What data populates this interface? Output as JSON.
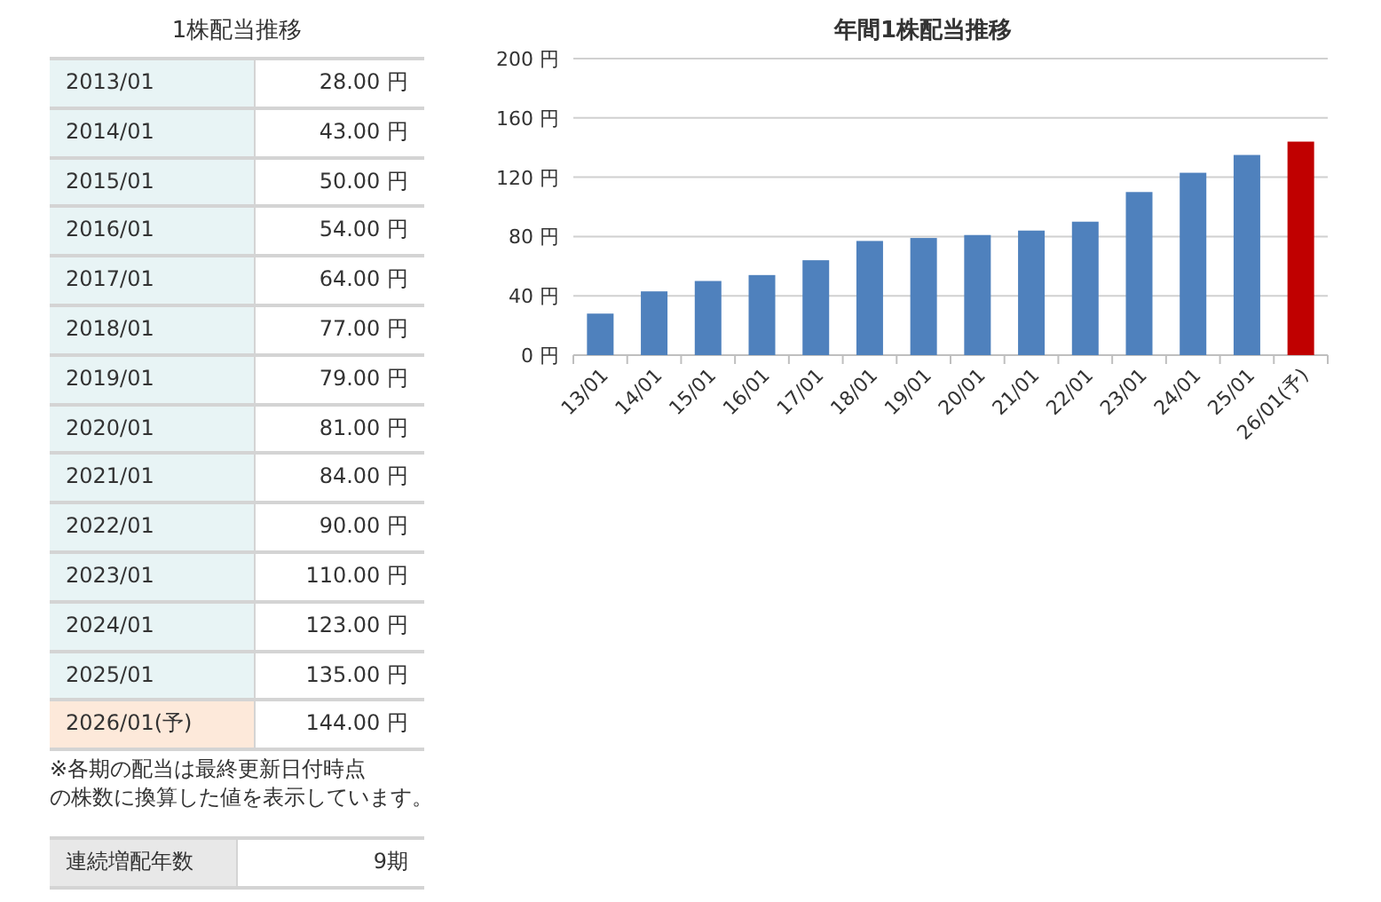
{
  "dividend_table": {
    "title": "1株配当推移",
    "rows": [
      {
        "kind": "actual",
        "period": "2013/01",
        "amount": "28.00 円"
      },
      {
        "kind": "actual",
        "period": "2014/01",
        "amount": "43.00 円"
      },
      {
        "kind": "actual",
        "period": "2015/01",
        "amount": "50.00 円"
      },
      {
        "kind": "actual",
        "period": "2016/01",
        "amount": "54.00 円"
      },
      {
        "kind": "actual",
        "period": "2017/01",
        "amount": "64.00 円"
      },
      {
        "kind": "actual",
        "period": "2018/01",
        "amount": "77.00 円"
      },
      {
        "kind": "actual",
        "period": "2019/01",
        "amount": "79.00 円"
      },
      {
        "kind": "actual",
        "period": "2020/01",
        "amount": "81.00 円"
      },
      {
        "kind": "actual",
        "period": "2021/01",
        "amount": "84.00 円"
      },
      {
        "kind": "actual",
        "period": "2022/01",
        "amount": "90.00 円"
      },
      {
        "kind": "actual",
        "period": "2023/01",
        "amount": "110.00 円"
      },
      {
        "kind": "actual",
        "period": "2024/01",
        "amount": "123.00 円"
      },
      {
        "kind": "actual",
        "period": "2025/01",
        "amount": "135.00 円"
      },
      {
        "kind": "forecast",
        "period": "2026/01(予)",
        "amount": "144.00 円"
      }
    ],
    "note_lines": [
      "※各期の配当は最終更新日付時点",
      "の株数に換算した値を表示しています。"
    ]
  },
  "streak": {
    "label": "連続増配年数",
    "value": "9期"
  },
  "chart": {
    "chart_data": {
      "type": "bar",
      "title": "年間1株配当推移",
      "grid": true,
      "categories": [
        "13/01",
        "14/01",
        "15/01",
        "16/01",
        "17/01",
        "18/01",
        "19/01",
        "20/01",
        "21/01",
        "22/01",
        "23/01",
        "24/01",
        "25/01",
        "26/01(予)"
      ],
      "series": [
        {
          "color": "#4f81bd",
          "values": [
            28,
            43,
            50,
            54,
            64,
            77,
            79,
            81,
            84,
            90,
            110,
            123,
            135,
            null
          ]
        },
        {
          "color": "#c00000",
          "values": [
            null,
            null,
            null,
            null,
            null,
            null,
            null,
            null,
            null,
            null,
            null,
            null,
            null,
            144
          ]
        }
      ],
      "ylim": [
        0,
        200
      ],
      "yticks": [
        {
          "value": 0,
          "label": "0 円"
        },
        {
          "value": 40,
          "label": "40 円"
        },
        {
          "value": 80,
          "label": "80 円"
        },
        {
          "value": 120,
          "label": "120 円"
        },
        {
          "value": 160,
          "label": "160 円"
        },
        {
          "value": 200,
          "label": "200 円"
        }
      ]
    }
  }
}
